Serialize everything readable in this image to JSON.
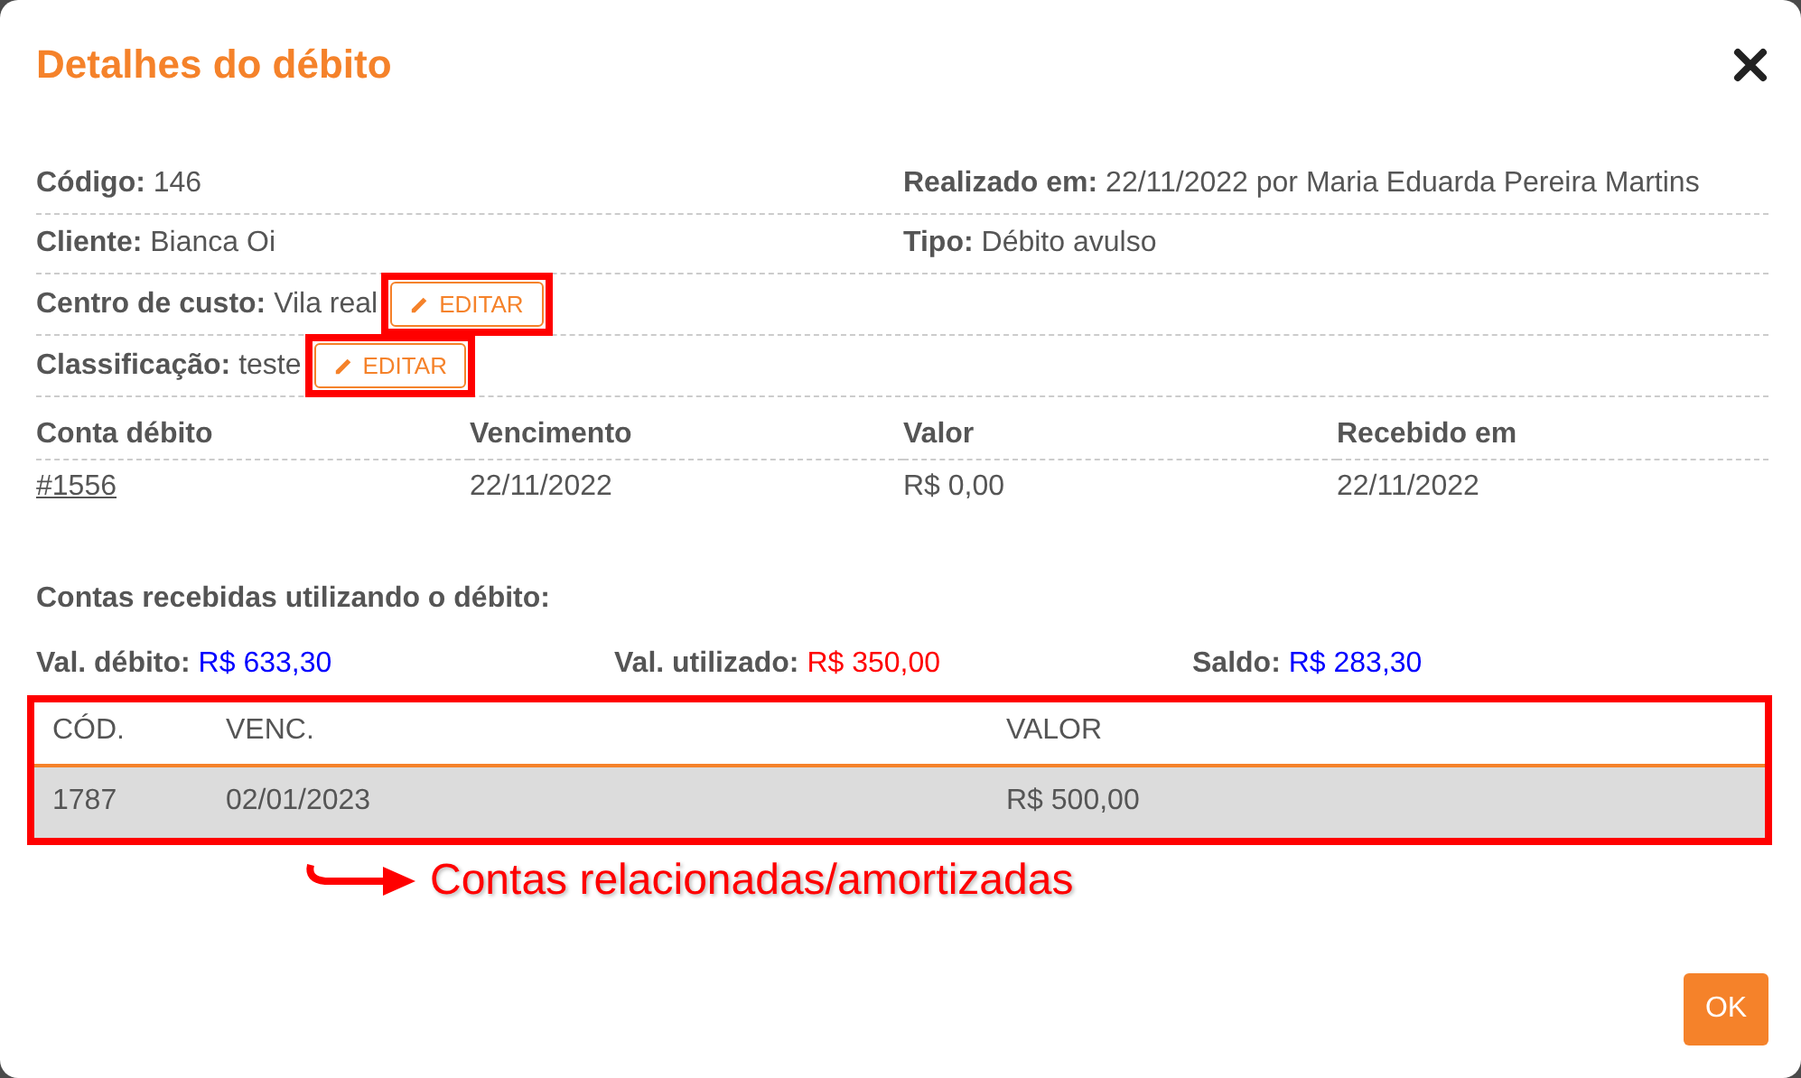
{
  "dialog": {
    "title": "Detalhes do débito"
  },
  "details": [
    {
      "cells": [
        {
          "label": "Código:",
          "value": "146"
        },
        {
          "label": "Realizado em:",
          "value": "22/11/2022 por Maria Eduarda Pereira Martins"
        }
      ]
    },
    {
      "cells": [
        {
          "label": "Cliente:",
          "value": "Bianca Oi"
        },
        {
          "label": "Tipo:",
          "value": "Débito avulso"
        }
      ]
    },
    {
      "cells": [
        {
          "label": "Centro de custo:",
          "value": "Vila real",
          "edit_button": {
            "label": "EDITAR",
            "highlighted": true
          }
        }
      ]
    },
    {
      "cells": [
        {
          "label": "Classificação:",
          "value": "teste",
          "edit_button": {
            "label": "EDITAR",
            "highlighted": true
          }
        }
      ]
    }
  ],
  "account": {
    "columns": [
      "Conta débito",
      "Vencimento",
      "Valor",
      "Recebido em"
    ],
    "values": [
      {
        "text": "#1556",
        "kind": "link"
      },
      {
        "text": "22/11/2022",
        "kind": "text"
      },
      {
        "text": "R$ 0,00",
        "kind": "text"
      },
      {
        "text": "22/11/2022",
        "kind": "text"
      }
    ]
  },
  "section_title": "Contas recebidas utilizando o débito:",
  "summary": [
    {
      "label": "Val. débito:",
      "value": "R$ 633,30",
      "color": "#0000ff"
    },
    {
      "label": "Val. utilizado:",
      "value": "R$ 350,00",
      "color": "#ff0000"
    },
    {
      "label": "Saldo:",
      "value": "R$ 283,30",
      "color": "#0000ff"
    }
  ],
  "related_table": {
    "highlighted": true,
    "columns": [
      "CÓD.",
      "VENC.",
      "VALOR"
    ],
    "rows": [
      {
        "cells": [
          "1787",
          "02/01/2023",
          "R$ 500,00"
        ],
        "selected": true
      }
    ]
  },
  "callout": {
    "text": "Contas relacionadas/amortizadas"
  },
  "ok_button": "OK"
}
